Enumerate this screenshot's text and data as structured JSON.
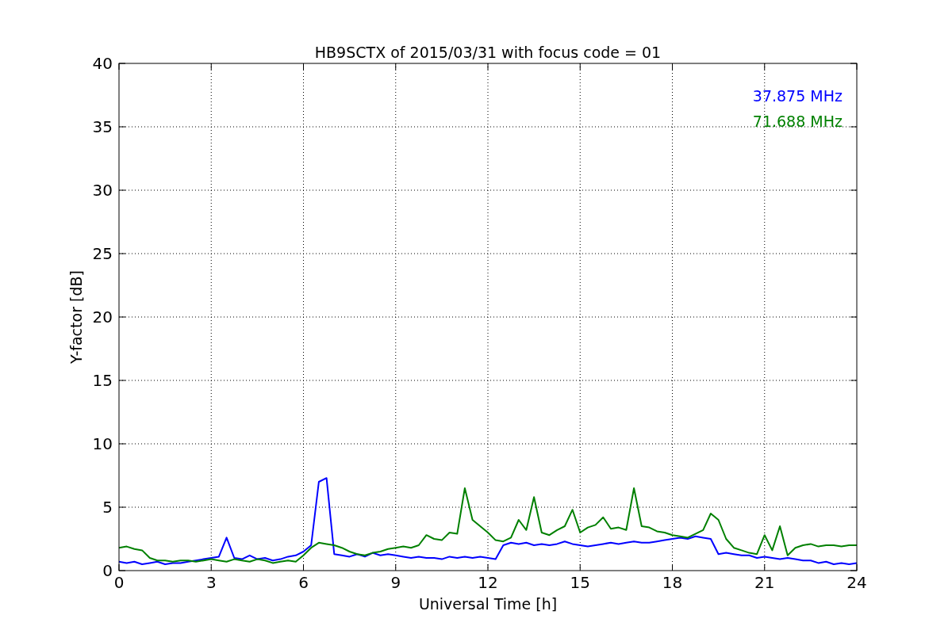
{
  "figure": {
    "chart_data": {
      "type": "line",
      "title": "HB9SCTX of 2015/03/31 with focus code = 01",
      "xlabel": "Universal Time [h]",
      "ylabel": "Y-factor [dB]",
      "xlim": [
        0,
        24
      ],
      "ylim": [
        0,
        40
      ],
      "grid": true,
      "xticks": [
        0,
        3,
        6,
        9,
        12,
        15,
        18,
        21,
        24
      ],
      "yticks": [
        0,
        5,
        10,
        15,
        20,
        25,
        30,
        35,
        40
      ],
      "x": [
        0,
        0.25,
        0.5,
        0.75,
        1,
        1.25,
        1.5,
        1.75,
        2,
        2.25,
        2.5,
        2.75,
        3,
        3.25,
        3.5,
        3.75,
        4,
        4.25,
        4.5,
        4.75,
        5,
        5.25,
        5.5,
        5.75,
        6,
        6.25,
        6.5,
        6.75,
        7,
        7.25,
        7.5,
        7.75,
        8,
        8.25,
        8.5,
        8.75,
        9,
        9.25,
        9.5,
        9.75,
        10,
        10.25,
        10.5,
        10.75,
        11,
        11.25,
        11.5,
        11.75,
        12,
        12.25,
        12.5,
        12.75,
        13,
        13.25,
        13.5,
        13.75,
        14,
        14.25,
        14.5,
        14.75,
        15,
        15.25,
        15.5,
        15.75,
        16,
        16.25,
        16.5,
        16.75,
        17,
        17.25,
        17.5,
        17.75,
        18,
        18.25,
        18.5,
        18.75,
        19,
        19.25,
        19.5,
        19.75,
        20,
        20.25,
        20.5,
        20.75,
        21,
        21.25,
        21.5,
        21.75,
        22,
        22.25,
        22.5,
        22.75,
        23,
        23.25,
        23.5,
        23.75,
        24
      ],
      "series": [
        {
          "name": "37.875 MHz",
          "color": "#0000ff",
          "values": [
            0.7,
            0.6,
            0.7,
            0.5,
            0.6,
            0.7,
            0.5,
            0.6,
            0.6,
            0.7,
            0.8,
            0.9,
            1.0,
            1.1,
            2.6,
            1.0,
            0.9,
            1.2,
            0.9,
            1.0,
            0.8,
            0.9,
            1.1,
            1.2,
            1.5,
            2.0,
            7.0,
            7.3,
            1.3,
            1.2,
            1.1,
            1.3,
            1.1,
            1.4,
            1.2,
            1.3,
            1.2,
            1.1,
            1.0,
            1.1,
            1.0,
            1.0,
            0.9,
            1.1,
            1.0,
            1.1,
            1.0,
            1.1,
            1.0,
            0.9,
            2.0,
            2.2,
            2.1,
            2.2,
            2.0,
            2.1,
            2.0,
            2.1,
            2.3,
            2.1,
            2.0,
            1.9,
            2.0,
            2.1,
            2.2,
            2.1,
            2.2,
            2.3,
            2.2,
            2.2,
            2.3,
            2.4,
            2.5,
            2.6,
            2.5,
            2.7,
            2.6,
            2.5,
            1.3,
            1.4,
            1.3,
            1.2,
            1.2,
            1.0,
            1.1,
            1.0,
            0.9,
            1.0,
            0.9,
            0.8,
            0.8,
            0.6,
            0.7,
            0.5,
            0.6,
            0.5,
            0.6
          ]
        },
        {
          "name": "71.688 MHz",
          "color": "#008000",
          "values": [
            1.8,
            1.9,
            1.7,
            1.6,
            1.0,
            0.8,
            0.8,
            0.7,
            0.8,
            0.8,
            0.7,
            0.8,
            0.9,
            0.8,
            0.7,
            0.9,
            0.8,
            0.7,
            0.9,
            0.8,
            0.6,
            0.7,
            0.8,
            0.7,
            1.2,
            1.8,
            2.2,
            2.1,
            2.0,
            1.8,
            1.5,
            1.3,
            1.2,
            1.4,
            1.5,
            1.7,
            1.8,
            1.9,
            1.8,
            2.0,
            2.8,
            2.5,
            2.4,
            3.0,
            2.9,
            6.5,
            4.0,
            3.5,
            3.0,
            2.4,
            2.3,
            2.6,
            4.0,
            3.2,
            5.8,
            3.0,
            2.8,
            3.2,
            3.5,
            4.8,
            3.0,
            3.4,
            3.6,
            4.2,
            3.3,
            3.4,
            3.2,
            6.5,
            3.5,
            3.4,
            3.1,
            3.0,
            2.8,
            2.7,
            2.6,
            2.9,
            3.2,
            4.5,
            4.0,
            2.5,
            1.8,
            1.6,
            1.4,
            1.3,
            2.8,
            1.6,
            3.5,
            1.2,
            1.8,
            2.0,
            2.1,
            1.9,
            2.0,
            2.0,
            1.9,
            2.0,
            2.0
          ]
        }
      ]
    }
  }
}
